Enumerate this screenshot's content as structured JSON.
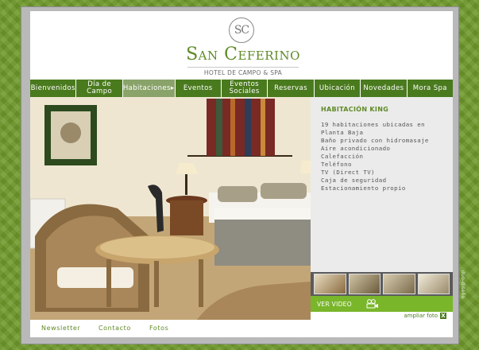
{
  "brand": {
    "monogram": "SC",
    "name": "San Ceferino",
    "subtitle": "HOTEL DE CAMPO & SPA"
  },
  "nav": {
    "items": [
      {
        "label": "Bienvenidos",
        "active": false
      },
      {
        "label": "Día de Campo",
        "active": false
      },
      {
        "label": "Habitaciones▸",
        "active": true
      },
      {
        "label": "Eventos",
        "active": false
      },
      {
        "label": "Eventos Sociales",
        "active": false
      },
      {
        "label": "Reservas",
        "active": false
      },
      {
        "label": "Ubicación",
        "active": false
      },
      {
        "label": "Novedades",
        "active": false
      },
      {
        "label": "Mora Spa",
        "active": false
      }
    ]
  },
  "room": {
    "title": "HABITACIÓN KING",
    "features": [
      "19 habitaciones ubicadas en",
      "Planta Baja",
      "Baño privado con hidromasaje",
      "Aire acondicionado",
      "Calefacción",
      "Teléfono",
      "TV (Direct TV)",
      "Caja de seguridad",
      "Estacionamiento propio"
    ]
  },
  "gallery": {
    "video_label": "VER VIDEO",
    "video_icon": "video-camera-icon",
    "zoom_label": "ampliar foto",
    "close_glyph": "X"
  },
  "footer": {
    "links": [
      "Newsletter",
      "Contacto",
      "Fotos"
    ]
  },
  "credit": "duo-diseño",
  "colors": {
    "brand_green": "#5f8a26",
    "nav_green": "#4a7a1e",
    "nav_active": "#8aa36a",
    "video_green": "#79b62a",
    "background": "#6f9a2c"
  }
}
